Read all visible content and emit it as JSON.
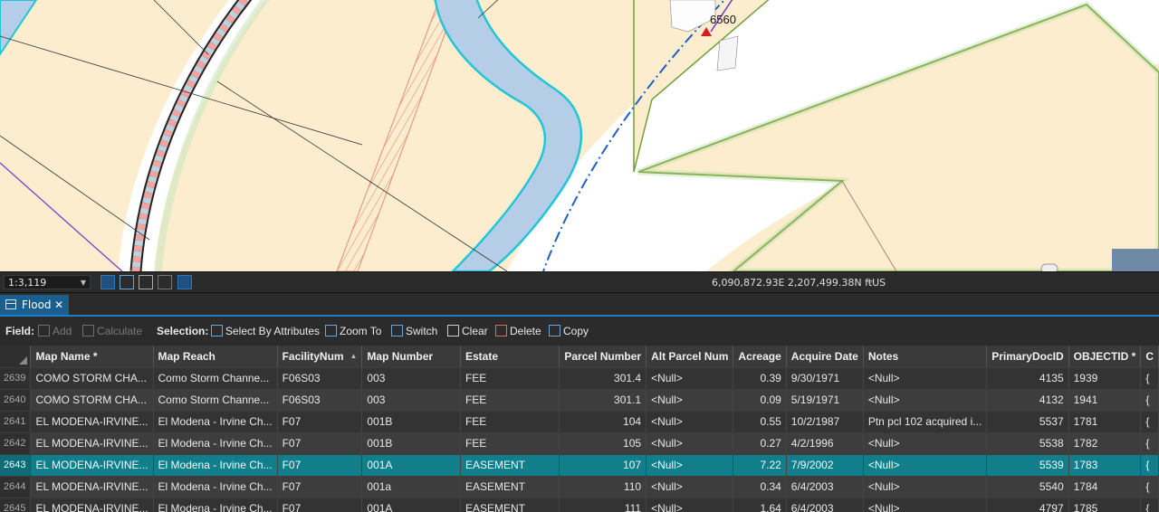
{
  "map": {
    "point_label": "6560",
    "colors": {
      "parcel": "#fbedcd",
      "channel": "#b5cde6",
      "channel_outline": "#21c6d8",
      "parcel_outline": "#6ea03a"
    }
  },
  "statusbar": {
    "scale": "1:3,119",
    "coordinates": "6,090,872.93E 2,207,499.38N ftUS"
  },
  "tab": {
    "label": "Flood",
    "close_glyph": "✕"
  },
  "toolbar": {
    "field_label": "Field:",
    "add_label": "Add",
    "calculate_label": "Calculate",
    "selection_label": "Selection:",
    "select_by_attributes_label": "Select By Attributes",
    "zoom_to_label": "Zoom To",
    "switch_label": "Switch",
    "clear_label": "Clear",
    "delete_label": "Delete",
    "copy_label": "Copy"
  },
  "table": {
    "columns": [
      "Map Name *",
      "Map Reach",
      "FacilityNum",
      "Map Number",
      "Estate",
      "Parcel Number",
      "Alt Parcel Num",
      "Acreage",
      "Acquire Date",
      "Notes",
      "PrimaryDocID",
      "OBJECTID *",
      "C"
    ],
    "rows": [
      {
        "row": "2639",
        "cells": [
          "COMO STORM CHA...",
          "Como Storm Channe...",
          "F06S03",
          "003",
          "FEE",
          "301.4",
          "<Null>",
          "0.39",
          "9/30/1971",
          "<Null>",
          "4135",
          "1939",
          "{"
        ]
      },
      {
        "row": "2640",
        "cells": [
          "COMO STORM CHA...",
          "Como Storm Channe...",
          "F06S03",
          "003",
          "FEE",
          "301.1",
          "<Null>",
          "0.09",
          "5/19/1971",
          "<Null>",
          "4132",
          "1941",
          "{"
        ]
      },
      {
        "row": "2641",
        "cells": [
          "EL MODENA-IRVINE...",
          "El Modena - Irvine Ch...",
          "F07",
          "001B",
          "FEE",
          "104",
          "<Null>",
          "0.55",
          "10/2/1987",
          "Ptn pcl 102 acquired i...",
          "5537",
          "1781",
          "{"
        ]
      },
      {
        "row": "2642",
        "cells": [
          "EL MODENA-IRVINE...",
          "El Modena - Irvine Ch...",
          "F07",
          "001B",
          "FEE",
          "105",
          "<Null>",
          "0.27",
          "4/2/1996",
          "<Null>",
          "5538",
          "1782",
          "{"
        ]
      },
      {
        "row": "2643",
        "cells": [
          "EL MODENA-IRVINE...",
          "El Modena - Irvine Ch...",
          "F07",
          "001A",
          "EASEMENT",
          "107",
          "<Null>",
          "7.22",
          "7/9/2002",
          "<Null>",
          "5539",
          "1783",
          "{"
        ]
      },
      {
        "row": "2644",
        "cells": [
          "EL MODENA-IRVINE...",
          "El Modena - Irvine Ch...",
          "F07",
          "001a",
          "EASEMENT",
          "110",
          "<Null>",
          "0.34",
          "6/4/2003",
          "<Null>",
          "5540",
          "1784",
          "{"
        ]
      },
      {
        "row": "2645",
        "cells": [
          "EL MODENA-IRVINE...",
          "El Modena - Irvine Ch...",
          "F07",
          "001A",
          "EASEMENT",
          "111",
          "<Null>",
          "1.64",
          "6/4/2003",
          "<Null>",
          "4797",
          "1785",
          "{"
        ]
      }
    ],
    "selected_row": "2643"
  }
}
